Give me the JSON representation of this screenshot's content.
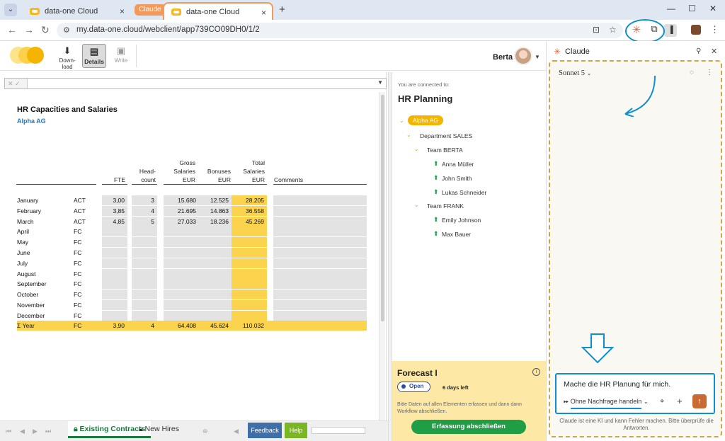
{
  "browser": {
    "tabs": [
      {
        "title": "data-one Cloud"
      },
      {
        "title": "data-one Cloud"
      }
    ],
    "tab_group": "Claude",
    "new_tab": "+",
    "url": "my.data-one.cloud/webclient/app739CO09DH0/1/2"
  },
  "toolbar": {
    "download": "Down-\nload",
    "details": "Details",
    "write": "Write",
    "user_name": "Berta"
  },
  "sheet": {
    "title": "HR Capacities and Salaries",
    "subtitle": "Alpha AG",
    "headers": {
      "fte": "FTE",
      "head_1": "Head-",
      "head_2": "count",
      "gross_1": "Gross",
      "gross_2": "Salaries",
      "gross_3": "EUR",
      "bonus_1": "Bonuses",
      "bonus_2": "EUR",
      "total_1": "Total",
      "total_2": "Salaries",
      "total_3": "EUR",
      "comments": "Comments"
    },
    "rows": [
      {
        "month": "January",
        "type": "ACT",
        "fte": "3,00",
        "head": "3",
        "gross": "15.680",
        "bonus": "12.525",
        "total": "28.205"
      },
      {
        "month": "February",
        "type": "ACT",
        "fte": "3,85",
        "head": "4",
        "gross": "21.695",
        "bonus": "14.863",
        "total": "36.558"
      },
      {
        "month": "March",
        "type": "ACT",
        "fte": "4,85",
        "head": "5",
        "gross": "27.033",
        "bonus": "18.236",
        "total": "45.269"
      },
      {
        "month": "April",
        "type": "FC",
        "fte": "",
        "head": "",
        "gross": "",
        "bonus": "",
        "total": ""
      },
      {
        "month": "May",
        "type": "FC",
        "fte": "",
        "head": "",
        "gross": "",
        "bonus": "",
        "total": ""
      },
      {
        "month": "June",
        "type": "FC",
        "fte": "",
        "head": "",
        "gross": "",
        "bonus": "",
        "total": ""
      },
      {
        "month": "July",
        "type": "FC",
        "fte": "",
        "head": "",
        "gross": "",
        "bonus": "",
        "total": ""
      },
      {
        "month": "August",
        "type": "FC",
        "fte": "",
        "head": "",
        "gross": "",
        "bonus": "",
        "total": ""
      },
      {
        "month": "September",
        "type": "FC",
        "fte": "",
        "head": "",
        "gross": "",
        "bonus": "",
        "total": ""
      },
      {
        "month": "October",
        "type": "FC",
        "fte": "",
        "head": "",
        "gross": "",
        "bonus": "",
        "total": ""
      },
      {
        "month": "November",
        "type": "FC",
        "fte": "",
        "head": "",
        "gross": "",
        "bonus": "",
        "total": ""
      },
      {
        "month": "December",
        "type": "FC",
        "fte": "",
        "head": "",
        "gross": "",
        "bonus": "",
        "total": ""
      }
    ],
    "year_row": {
      "month": "Σ Year",
      "type": "FC",
      "fte": "3,90",
      "head": "4",
      "gross": "64.408",
      "bonus": "45.624",
      "total": "110.032"
    },
    "tabs": {
      "existing": "Existing Contracts",
      "new_hires": "New Hires"
    },
    "feedback": "Feedback",
    "help": "Help"
  },
  "hierarchy": {
    "connected_label": "You are connected to:",
    "model_title": "HR Planning",
    "company": "Alpha AG",
    "department": "Department SALES",
    "team1": "Team BERTA",
    "team1_members": [
      "Anna Müller",
      "John Smith",
      "Lukas Schneider"
    ],
    "team2": "Team FRANK",
    "team2_members": [
      "Emily Johnson",
      "Max Bauer"
    ]
  },
  "forecast": {
    "title": "Forecast I",
    "status": "Open",
    "days_left": "6 days left",
    "description": "Bitte Daten auf allen Elementen erfassen und dann dann Workflow abschließen.",
    "button": "Erfassung abschließen"
  },
  "claude": {
    "title": "Claude",
    "model": "Sonnet 5",
    "prompt": "Mache die HR Planung für mich.",
    "mode": "Ohne Nachfrage handeln",
    "disclaimer": "Claude ist eine KI und kann Fehler machen. Bitte überprüfe die Antworten."
  },
  "colors": {
    "accent_yellow": "#fcd34d",
    "claude_orange": "#c96a32",
    "annotation_blue": "#0d8fd0",
    "green": "#1f9e45"
  }
}
